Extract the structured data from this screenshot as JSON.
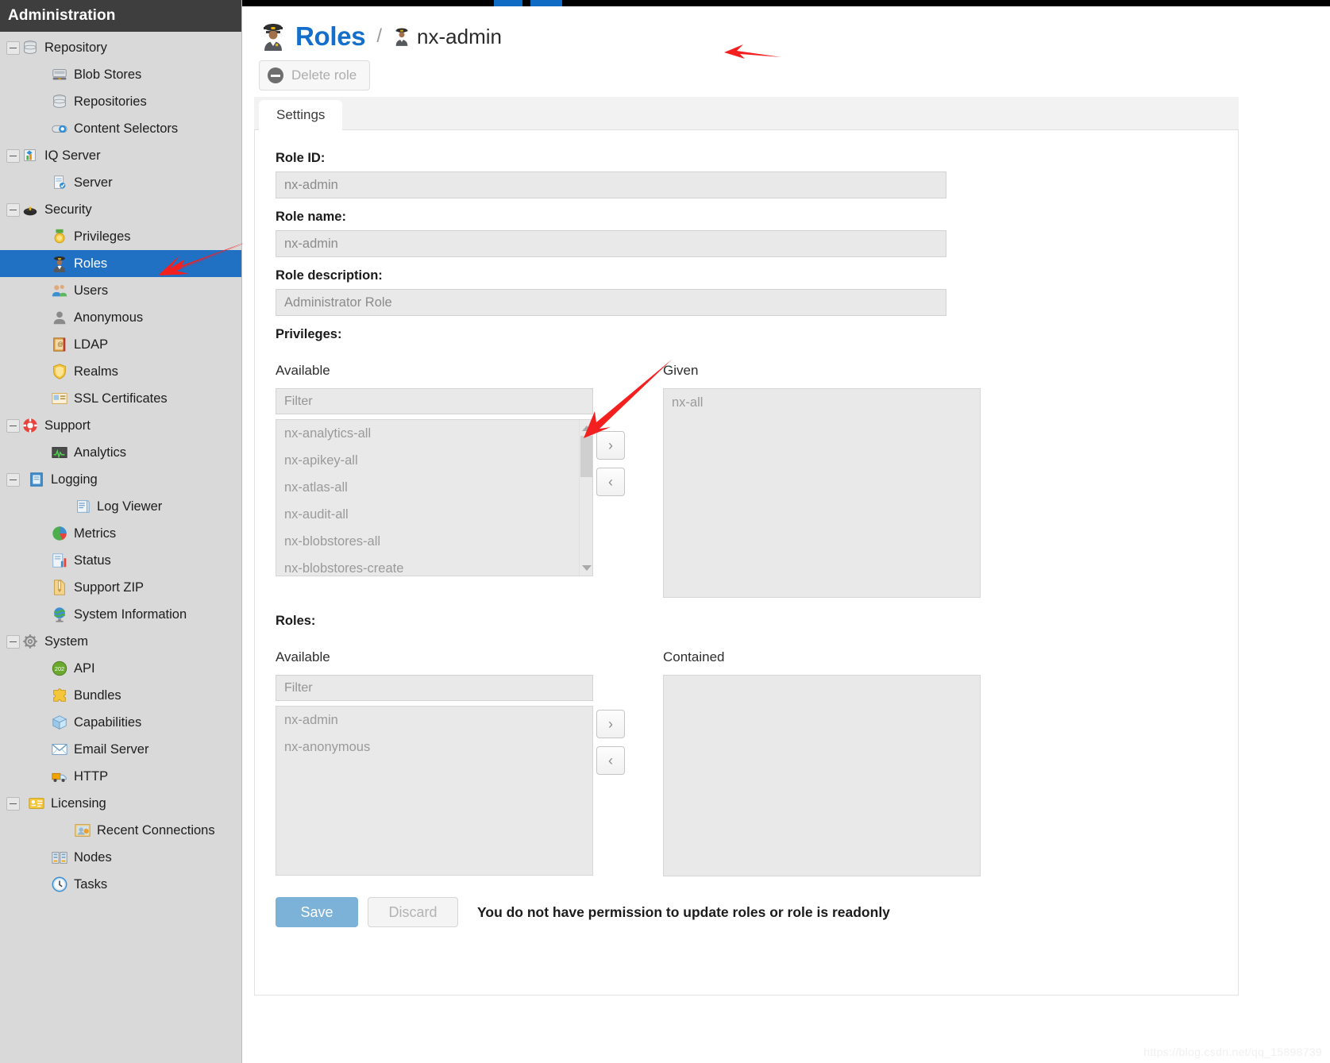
{
  "sidebar": {
    "header": "Administration",
    "selected_color": "#2071c4",
    "items": [
      {
        "label": "Repository",
        "level": 1,
        "icon": "database-icon",
        "toggle": true,
        "selected": false
      },
      {
        "label": "Blob Stores",
        "level": 2,
        "icon": "blob-store-icon",
        "toggle": false,
        "selected": false
      },
      {
        "label": "Repositories",
        "level": 2,
        "icon": "database-icon",
        "toggle": false,
        "selected": false
      },
      {
        "label": "Content Selectors",
        "level": 2,
        "icon": "content-selector-icon",
        "toggle": false,
        "selected": false
      },
      {
        "label": "IQ Server",
        "level": 1,
        "icon": "iq-server-icon",
        "toggle": true,
        "selected": false
      },
      {
        "label": "Server",
        "level": 2,
        "icon": "server-doc-icon",
        "toggle": false,
        "selected": false
      },
      {
        "label": "Security",
        "level": 1,
        "icon": "security-shield-icon",
        "toggle": true,
        "selected": false
      },
      {
        "label": "Privileges",
        "level": 2,
        "icon": "medal-icon",
        "toggle": false,
        "selected": false
      },
      {
        "label": "Roles",
        "level": 2,
        "icon": "role-person-icon",
        "toggle": false,
        "selected": true
      },
      {
        "label": "Users",
        "level": 2,
        "icon": "users-icon",
        "toggle": false,
        "selected": false
      },
      {
        "label": "Anonymous",
        "level": 2,
        "icon": "anonymous-icon",
        "toggle": false,
        "selected": false
      },
      {
        "label": "LDAP",
        "level": 2,
        "icon": "ldap-book-icon",
        "toggle": false,
        "selected": false
      },
      {
        "label": "Realms",
        "level": 2,
        "icon": "realm-shield-icon",
        "toggle": false,
        "selected": false
      },
      {
        "label": "SSL Certificates",
        "level": 2,
        "icon": "certificate-icon",
        "toggle": false,
        "selected": false
      },
      {
        "label": "Support",
        "level": 1,
        "icon": "lifebuoy-icon",
        "toggle": true,
        "selected": false
      },
      {
        "label": "Analytics",
        "level": 2,
        "icon": "analytics-icon",
        "toggle": false,
        "selected": false
      },
      {
        "label": "Logging",
        "level": 2,
        "icon": "logging-book-icon",
        "toggle": true,
        "selected": false
      },
      {
        "label": "Log Viewer",
        "level": 3,
        "icon": "log-viewer-icon",
        "toggle": false,
        "selected": false
      },
      {
        "label": "Metrics",
        "level": 2,
        "icon": "pie-chart-icon",
        "toggle": false,
        "selected": false
      },
      {
        "label": "Status",
        "level": 2,
        "icon": "status-chart-icon",
        "toggle": false,
        "selected": false
      },
      {
        "label": "Support ZIP",
        "level": 2,
        "icon": "zip-file-icon",
        "toggle": false,
        "selected": false
      },
      {
        "label": "System Information",
        "level": 2,
        "icon": "globe-icon",
        "toggle": false,
        "selected": false
      },
      {
        "label": "System",
        "level": 1,
        "icon": "gear-icon",
        "toggle": true,
        "selected": false
      },
      {
        "label": "API",
        "level": 2,
        "icon": "api-badge-icon",
        "toggle": false,
        "selected": false
      },
      {
        "label": "Bundles",
        "level": 2,
        "icon": "puzzle-icon",
        "toggle": false,
        "selected": false
      },
      {
        "label": "Capabilities",
        "level": 2,
        "icon": "box-icon",
        "toggle": false,
        "selected": false
      },
      {
        "label": "Email Server",
        "level": 2,
        "icon": "envelope-icon",
        "toggle": false,
        "selected": false
      },
      {
        "label": "HTTP",
        "level": 2,
        "icon": "truck-icon",
        "toggle": false,
        "selected": false
      },
      {
        "label": "Licensing",
        "level": 2,
        "icon": "license-card-icon",
        "toggle": true,
        "selected": false
      },
      {
        "label": "Recent Connections",
        "level": 3,
        "icon": "recent-connection-icon",
        "toggle": false,
        "selected": false
      },
      {
        "label": "Nodes",
        "level": 2,
        "icon": "nodes-icon",
        "toggle": false,
        "selected": false
      },
      {
        "label": "Tasks",
        "level": 2,
        "icon": "clock-icon",
        "toggle": false,
        "selected": false
      }
    ]
  },
  "header": {
    "title": "Roles",
    "title_color": "#136fcb",
    "separator": "/",
    "current": "nx-admin"
  },
  "toolbar": {
    "delete_role_label": "Delete role"
  },
  "tabs": [
    {
      "label": "Settings",
      "active": true
    }
  ],
  "form": {
    "role_id": {
      "label": "Role ID:",
      "value": "nx-admin"
    },
    "role_name": {
      "label": "Role name:",
      "value": "nx-admin"
    },
    "role_description": {
      "label": "Role description:",
      "value": "Administrator Role"
    },
    "privileges": {
      "section_label": "Privileges:",
      "available_title": "Available",
      "given_title": "Given",
      "filter_placeholder": "Filter",
      "available_items": [
        "nx-analytics-all",
        "nx-apikey-all",
        "nx-atlas-all",
        "nx-audit-all",
        "nx-blobstores-all",
        "nx-blobstores-create"
      ],
      "given_items": [
        "nx-all"
      ],
      "add_button": "›",
      "remove_button": "‹"
    },
    "roles": {
      "section_label": "Roles:",
      "available_title": "Available",
      "contained_title": "Contained",
      "filter_placeholder": "Filter",
      "available_items": [
        "nx-admin",
        "nx-anonymous"
      ],
      "contained_items": [],
      "add_button": "›",
      "remove_button": "‹"
    }
  },
  "footer": {
    "save_label": "Save",
    "save_color": "#7cb1d8",
    "discard_label": "Discard",
    "permission_message": "You do not have permission to update roles or role is readonly"
  },
  "watermark": "https://blog.csdn.net/qq_15898739"
}
